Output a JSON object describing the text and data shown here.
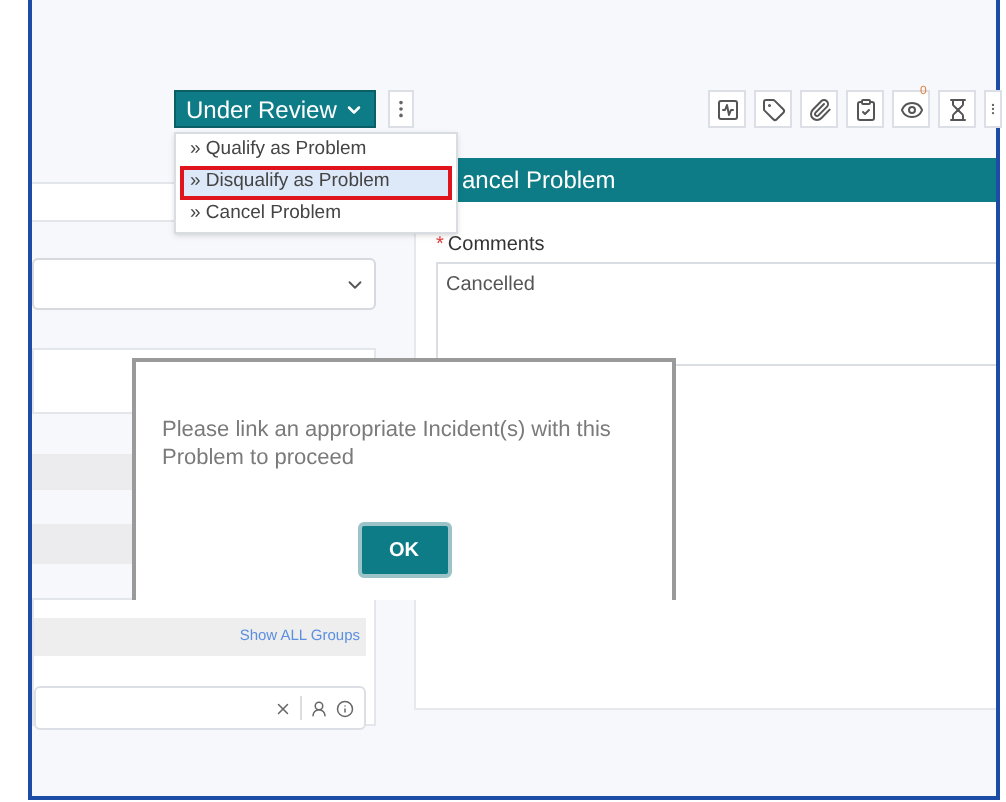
{
  "status_button": {
    "label": "Under Review"
  },
  "status_menu": {
    "items": [
      {
        "label": "» Qualify as Problem",
        "selected": false
      },
      {
        "label": "» Disqualify as Problem",
        "selected": true
      },
      {
        "label": "» Cancel Problem",
        "selected": false
      }
    ]
  },
  "toolbar": {
    "watchers_badge": "0"
  },
  "panel": {
    "title": "ancel Problem",
    "comments_label": "Comments",
    "required": true,
    "required_mark": "*",
    "comments_value": "Cancelled"
  },
  "groups": {
    "link": "Show ALL Groups"
  },
  "dialog": {
    "message": "Please link an appropriate Incident(s) with this Problem to proceed",
    "ok": "OK"
  }
}
